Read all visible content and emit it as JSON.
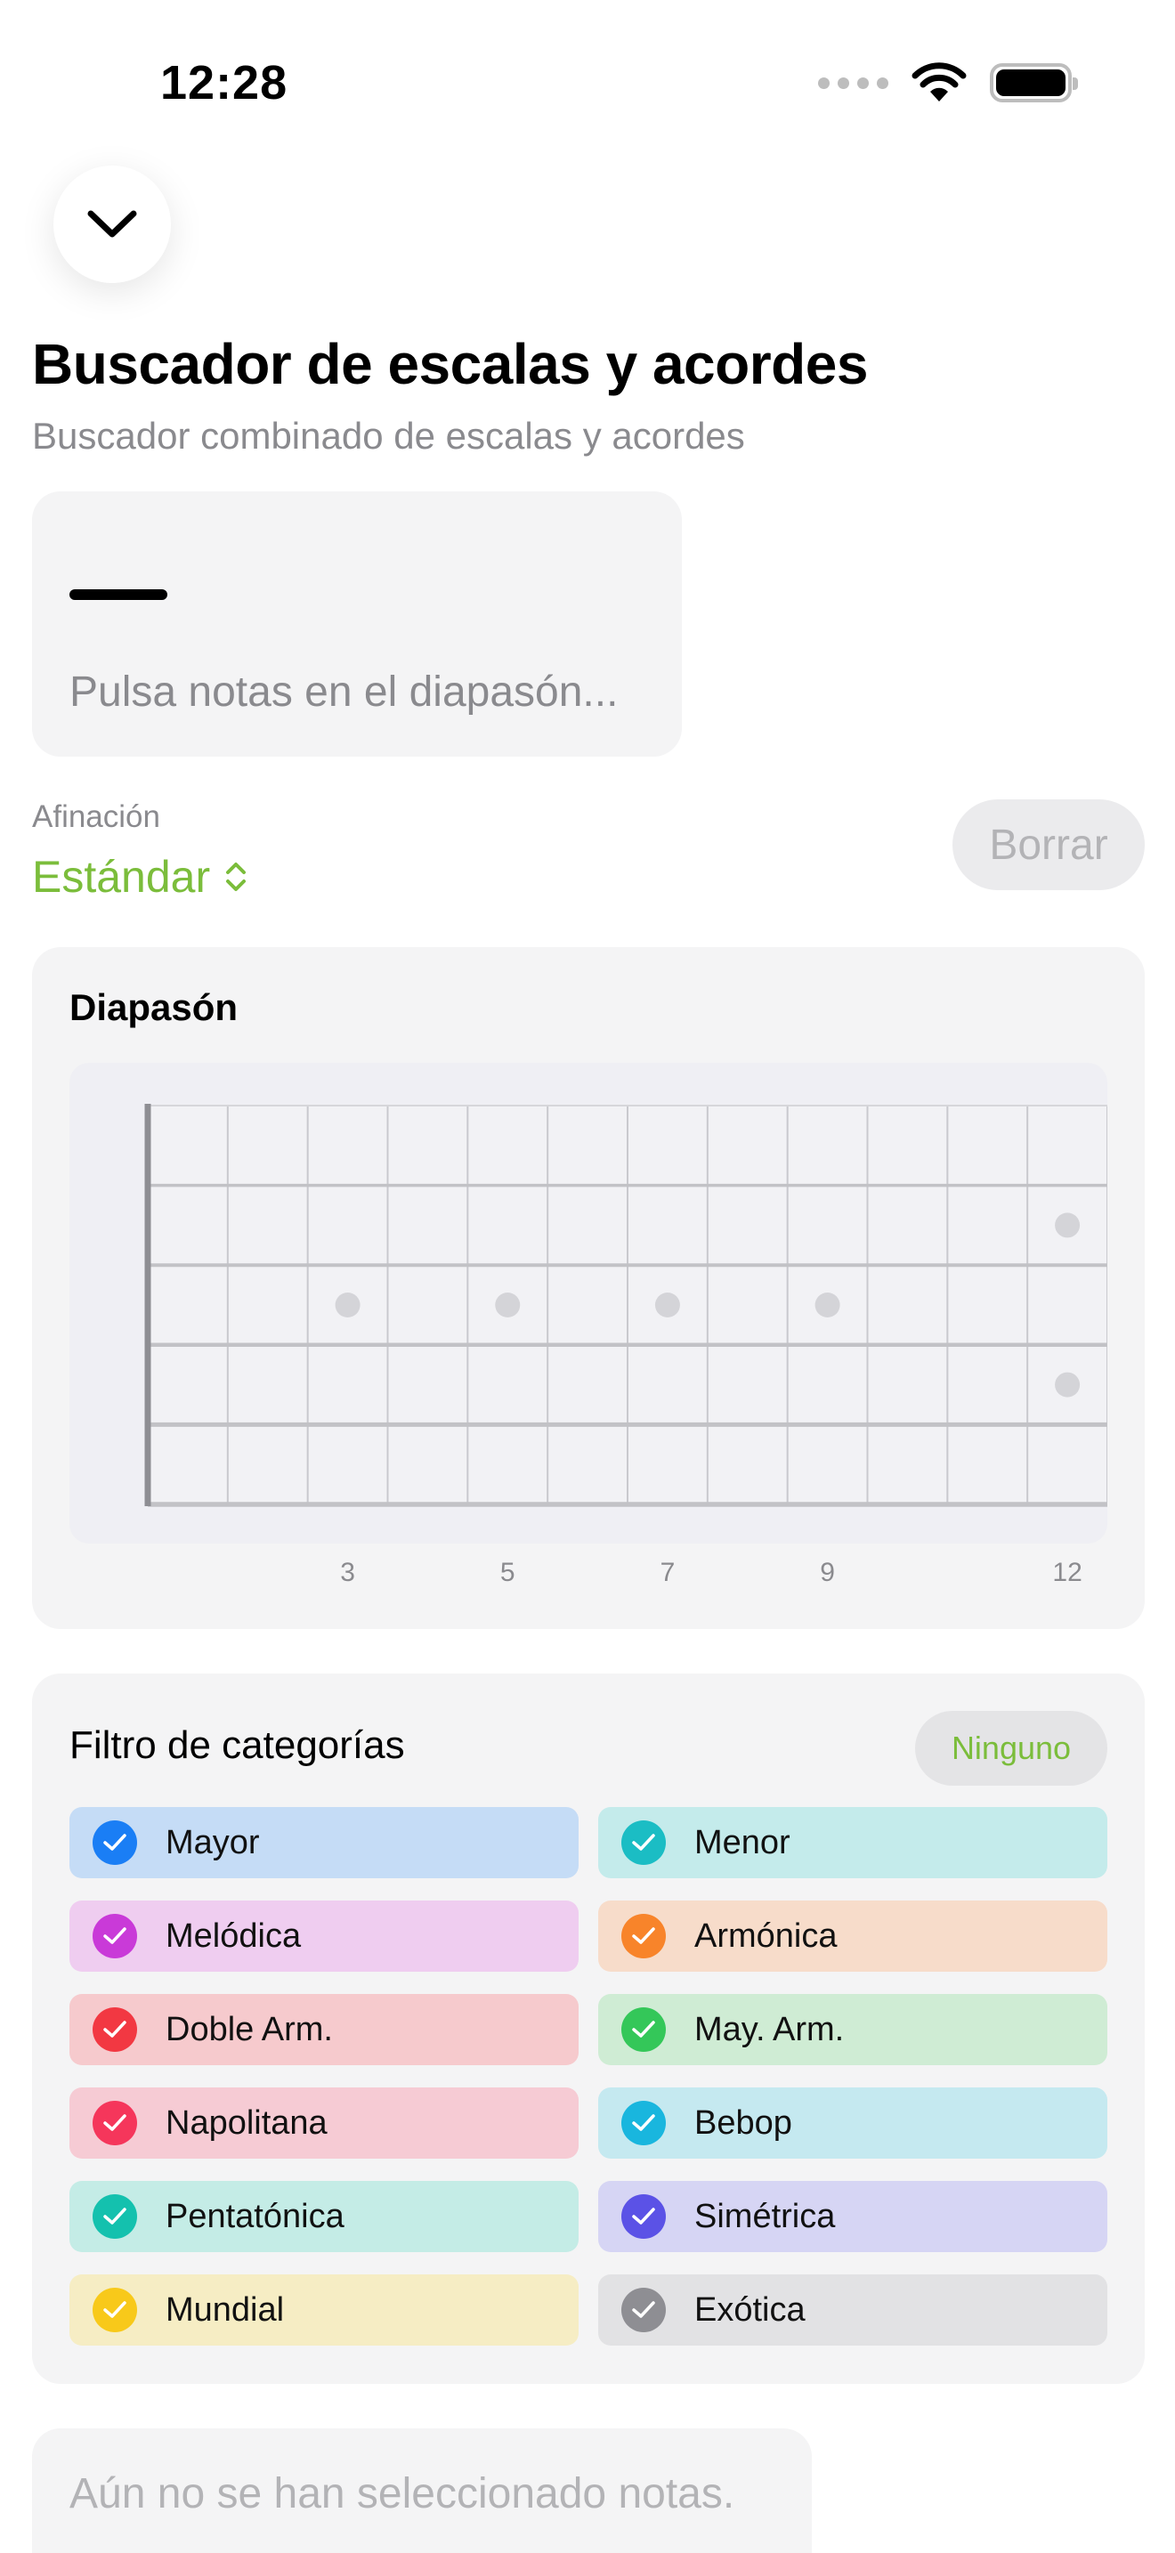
{
  "status": {
    "time": "12:28",
    "icons": [
      "signal-dots-icon",
      "wifi-icon",
      "battery-icon"
    ]
  },
  "header": {
    "dismiss_icon": "chevron-down-icon",
    "title": "Buscador de escalas y acordes",
    "subtitle": "Buscador combinado de escalas y acordes"
  },
  "notes": {
    "placeholder": "Pulsa notas en el diapasón..."
  },
  "tuning": {
    "label": "Afinación",
    "value": "Estándar",
    "clear_label": "Borrar"
  },
  "fretboard": {
    "title": "Diapasón",
    "frets": 12,
    "strings": 6,
    "single_markers": [
      3,
      5,
      7,
      9
    ],
    "double_markers": [
      12
    ],
    "fret_numbers": [
      "3",
      "5",
      "7",
      "9",
      "12"
    ]
  },
  "categories": {
    "title": "Filtro de categorías",
    "none_label": "Ninguno",
    "items": [
      {
        "label": "Mayor",
        "checked": true,
        "color": "#1a7ef5",
        "bg": "#c5dcf6"
      },
      {
        "label": "Menor",
        "checked": true,
        "color": "#1bbdc4",
        "bg": "#c4ebeb"
      },
      {
        "label": "Melódica",
        "checked": true,
        "color": "#c93ad8",
        "bg": "#efcdf0"
      },
      {
        "label": "Armónica",
        "checked": true,
        "color": "#f8842a",
        "bg": "#f7dcca"
      },
      {
        "label": "Doble Arm.",
        "checked": true,
        "color": "#f23842",
        "bg": "#f6cacd"
      },
      {
        "label": "May. Arm.",
        "checked": true,
        "color": "#34c759",
        "bg": "#cfecd4"
      },
      {
        "label": "Napolitana",
        "checked": true,
        "color": "#f5365b",
        "bg": "#f6cbd4"
      },
      {
        "label": "Bebop",
        "checked": true,
        "color": "#19b6de",
        "bg": "#c5e9f0"
      },
      {
        "label": "Pentatónica",
        "checked": true,
        "color": "#14c1ae",
        "bg": "#c4ece6"
      },
      {
        "label": "Simétrica",
        "checked": true,
        "color": "#5b52e6",
        "bg": "#d6d5f4"
      },
      {
        "label": "Mundial",
        "checked": true,
        "color": "#f8c91a",
        "bg": "#f6edc4"
      },
      {
        "label": "Exótica",
        "checked": true,
        "color": "#8e8e93",
        "bg": "#e2e2e4"
      }
    ]
  },
  "results": {
    "empty_text": "Aún no se han seleccionado notas."
  },
  "colors": {
    "accent": "#7bbd3b",
    "card": "#f4f4f5",
    "muted": "#8a8a8e"
  }
}
